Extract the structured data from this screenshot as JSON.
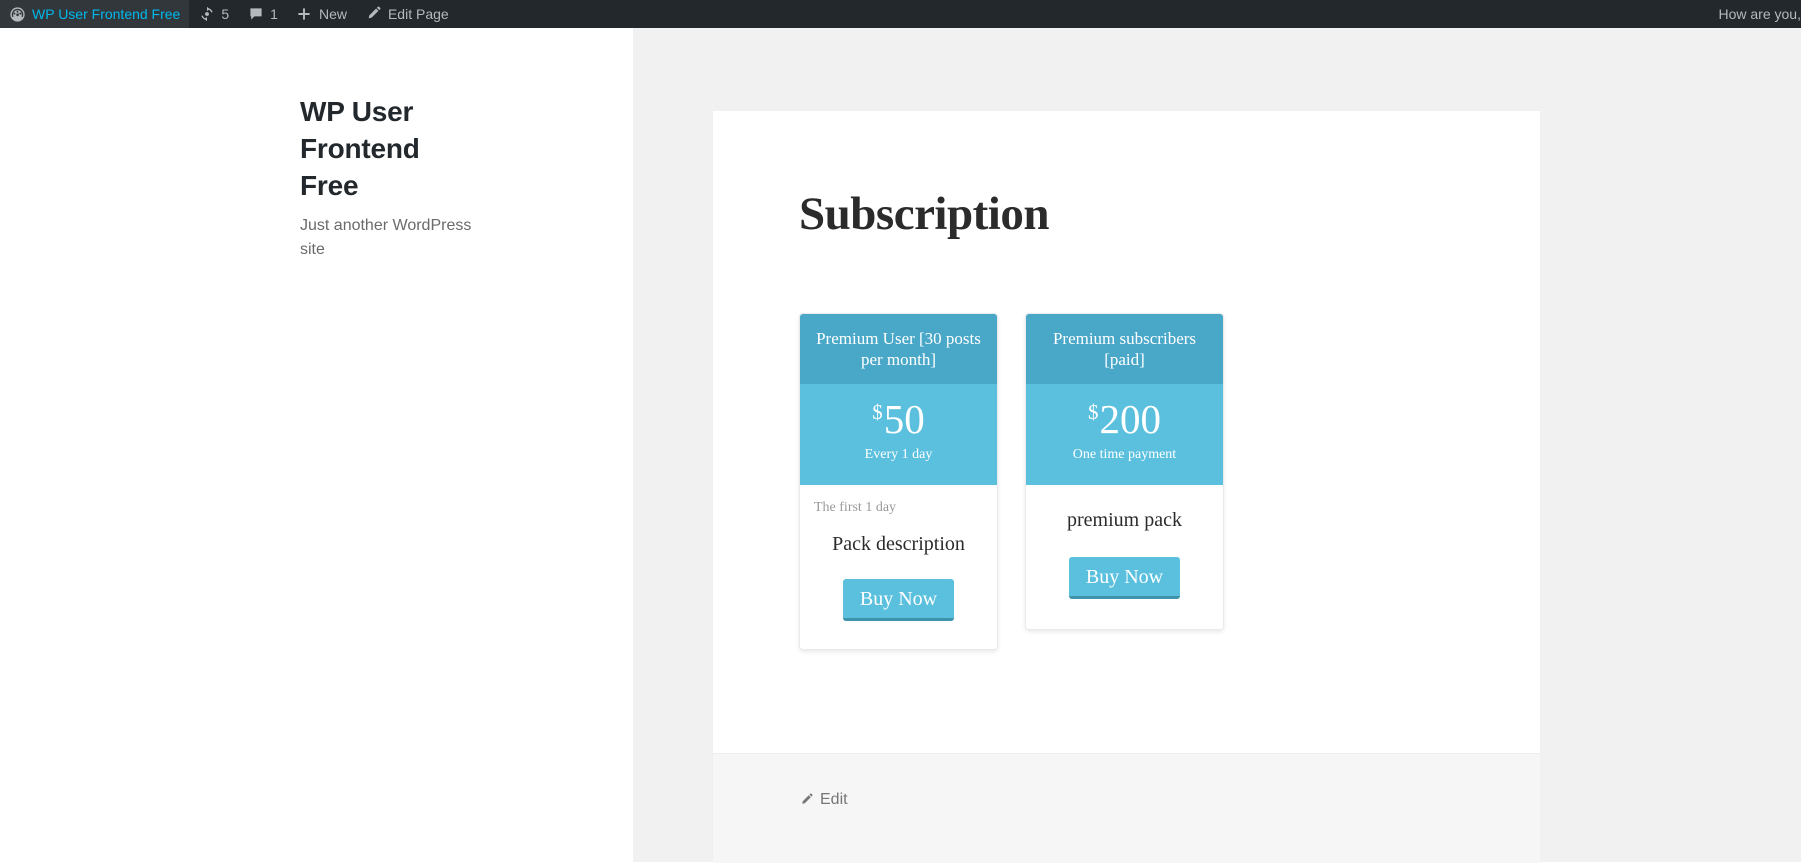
{
  "admin_bar": {
    "site_name": "WP User Frontend Free",
    "site_icon": "dashboard-icon",
    "updates": {
      "icon": "updates-icon",
      "count": "5"
    },
    "comments": {
      "icon": "comment-bubble-icon",
      "count": "1"
    },
    "new": {
      "icon": "plus-icon",
      "label": "New"
    },
    "edit_page": {
      "icon": "pencil-icon",
      "label": "Edit Page"
    },
    "howdy": "How are you, admin"
  },
  "sidebar": {
    "site_title": "WP User Frontend Free",
    "site_description": "Just another WordPress site"
  },
  "main": {
    "entry_title": "Subscription",
    "packs": [
      {
        "name": "Premium User [30 posts per month]",
        "currency": "$",
        "amount": "50",
        "period": "Every 1 day",
        "trial": "The first 1 day",
        "description": "Pack description",
        "buy_label": "Buy Now"
      },
      {
        "name": "Premium subscribers [paid]",
        "currency": "$",
        "amount": "200",
        "period": "One time payment",
        "trial": "",
        "description": "premium pack",
        "buy_label": "Buy Now"
      }
    ]
  },
  "footer": {
    "edit_label": "Edit",
    "edit_icon": "pencil-icon"
  },
  "colors": {
    "admin_bar_bg": "#23282d",
    "pack_header_bg": "#49a7c8",
    "pack_price_bg": "#5bc0de",
    "button_bg": "#5bc0de",
    "button_border": "#3e93ab",
    "page_bg": "#f1f1f1"
  }
}
